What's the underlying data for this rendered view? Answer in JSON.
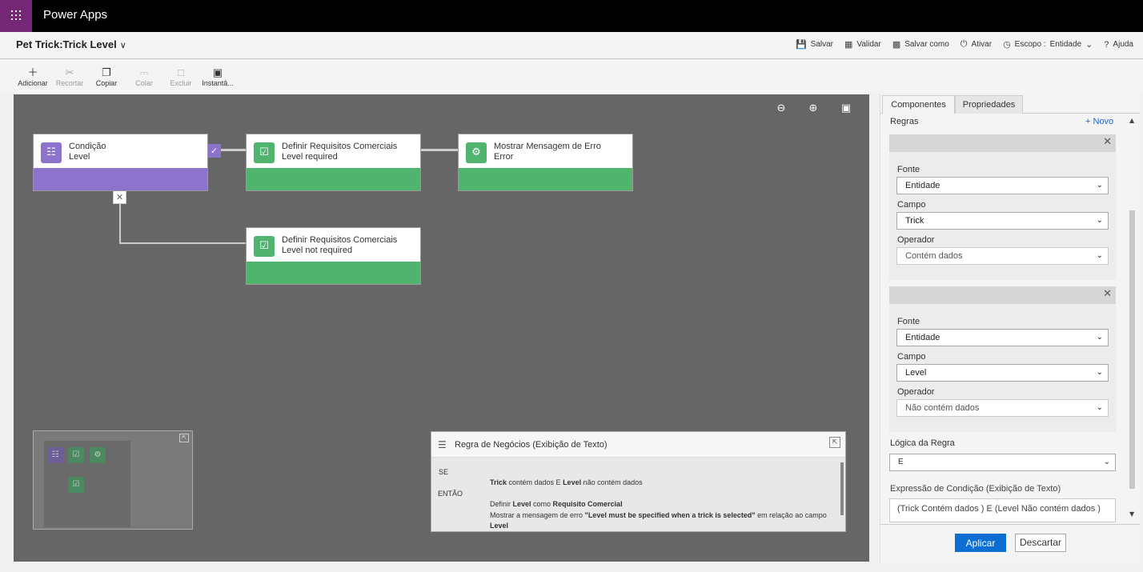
{
  "app": {
    "title": "Power Apps"
  },
  "header": {
    "entity_title": "Pet Trick:Trick Level",
    "chevron": "∨"
  },
  "commands": {
    "save": "Salvar",
    "validate": "Validar",
    "save_as": "Salvar como",
    "activate": "Ativar",
    "scope_label": "Escopo :",
    "scope_value": "Entidade",
    "help": "Ajuda"
  },
  "ribbon": {
    "add": "Adicionar",
    "cut": "Recortar",
    "copy": "Copiar",
    "paste": "Colar",
    "delete": "Excluir",
    "snapshot": "Instantâ..."
  },
  "canvas": {
    "nodes": {
      "condition": {
        "line1": "Condição",
        "line2": "Level"
      },
      "req1": {
        "line1": "Definir Requisitos Comerciais",
        "line2": "Level required"
      },
      "error": {
        "line1": "Mostrar Mensagem de Erro",
        "line2": "Error"
      },
      "req2": {
        "line1": "Definir Requisitos Comerciais",
        "line2": "Level not required"
      }
    }
  },
  "textview": {
    "title": "Regra de Negócios (Exibição de Texto)",
    "if_label": "SE",
    "then_label": "ENTÃO",
    "cond_field1": "Trick",
    "cond_op1": " contém dados E ",
    "cond_field2": "Level",
    "cond_op2": " não contém dados",
    "act1_prefix": "Definir ",
    "act1_field": "Level",
    "act1_mid": " como ",
    "act1_value": "Requisito Comercial",
    "act2_prefix": "Mostrar a mensagem de erro ",
    "act2_msg": "\"Level must be specified when a trick is selected\"",
    "act2_mid": " em relação ao campo ",
    "act2_field": "Level"
  },
  "panel": {
    "tabs": {
      "components": "Componentes",
      "properties": "Propriedades"
    },
    "rules_label": "Regras",
    "new_link": "+ Novo",
    "rule1": {
      "source_label": "Fonte",
      "source_value": "Entidade",
      "field_label": "Campo",
      "field_value": "Trick",
      "operator_label": "Operador",
      "operator_value": "Contém dados"
    },
    "rule2": {
      "source_label": "Fonte",
      "source_value": "Entidade",
      "field_label": "Campo",
      "field_value": "Level",
      "operator_label": "Operador",
      "operator_value": "Não contém dados"
    },
    "logic_label": "Lógica da Regra",
    "logic_value": "E",
    "expr_label": "Expressão de Condição (Exibição de Texto)",
    "expr_value": "(Trick Contém dados ) E (Level Não contém dados )",
    "apply": "Aplicar",
    "discard": "Descartar"
  },
  "colors": {
    "brand": "#742774",
    "condition": "#8c74cc",
    "action": "#51b46e",
    "apply": "#0b6ed3"
  }
}
